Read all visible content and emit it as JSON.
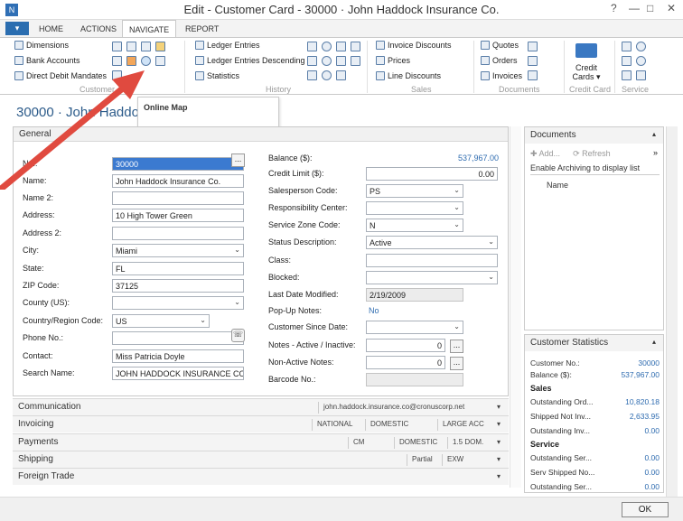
{
  "window": {
    "title": "Edit - Customer Card - 30000 · John Haddock Insurance Co.",
    "help": "?",
    "minimize": "—",
    "maximize": "□",
    "close": "✕"
  },
  "tabs": {
    "file": "▾",
    "home": "HOME",
    "actions": "ACTIONS",
    "navigate": "NAVIGATE",
    "report": "REPORT"
  },
  "ribbon": {
    "customer_group": {
      "dimensions": "Dimensions",
      "bank_accounts": "Bank Accounts",
      "direct_debit": "Direct Debit Mandates",
      "label": "Customer"
    },
    "history_group": {
      "ledger_entries": "Ledger Entries",
      "ledger_entries_desc": "Ledger Entries Descending",
      "statistics": "Statistics",
      "label": "History"
    },
    "sales_group": {
      "invoice_discounts": "Invoice Discounts",
      "prices": "Prices",
      "line_discounts": "Line Discounts",
      "label": "Sales"
    },
    "documents_group": {
      "quotes": "Quotes",
      "orders": "Orders",
      "invoices": "Invoices",
      "label": "Documents"
    },
    "credit_card_group": {
      "button": "Credit Cards ▾",
      "label": "Credit Card"
    },
    "service_group": {
      "label": "Service"
    }
  },
  "tooltip": {
    "text": "Online Map"
  },
  "page_title": "30000 · John Haddock",
  "general": {
    "header": "General",
    "fields_left": [
      {
        "label": "No.:",
        "value": "30000"
      },
      {
        "label": "Name:",
        "value": "John Haddock Insurance Co."
      },
      {
        "label": "Name 2:",
        "value": ""
      },
      {
        "label": "Address:",
        "value": "10 High Tower Green"
      },
      {
        "label": "Address 2:",
        "value": ""
      },
      {
        "label": "City:",
        "value": "Miami"
      },
      {
        "label": "State:",
        "value": "FL"
      },
      {
        "label": "ZIP Code:",
        "value": "37125"
      },
      {
        "label": "County (US):",
        "value": ""
      },
      {
        "label": "Country/Region Code:",
        "value": "US"
      },
      {
        "label": "Phone No.:",
        "value": ""
      },
      {
        "label": "Contact:",
        "value": "Miss Patricia Doyle"
      },
      {
        "label": "Search Name:",
        "value": "JOHN HADDOCK INSURANCE CO."
      }
    ],
    "fields_right": [
      {
        "label": "Balance ($):",
        "value": "537,967.00"
      },
      {
        "label": "Credit Limit ($):",
        "value": "0.00"
      },
      {
        "label": "Salesperson Code:",
        "value": "PS"
      },
      {
        "label": "Responsibility Center:",
        "value": ""
      },
      {
        "label": "Service Zone Code:",
        "value": "N"
      },
      {
        "label": "Status Description:",
        "value": "Active"
      },
      {
        "label": "Class:",
        "value": ""
      },
      {
        "label": "Blocked:",
        "value": ""
      },
      {
        "label": "Last Date Modified:",
        "value": "2/19/2009"
      },
      {
        "label": "Pop-Up Notes:",
        "value": "No"
      },
      {
        "label": "Customer Since Date:",
        "value": ""
      },
      {
        "label": "Notes - Active / Inactive:",
        "value": "0"
      },
      {
        "label": "Non-Active Notes:",
        "value": "0"
      },
      {
        "label": "Barcode No.:",
        "value": ""
      }
    ]
  },
  "collapsed_tabs": [
    {
      "label": "Communication",
      "summary": [
        "john.haddock.insurance.co@cronuscorp.net"
      ]
    },
    {
      "label": "Invoicing",
      "summary": [
        "NATIONAL",
        "DOMESTIC",
        "LARGE ACC"
      ]
    },
    {
      "label": "Payments",
      "summary": [
        "CM",
        "DOMESTIC",
        "1.5 DOM."
      ]
    },
    {
      "label": "Shipping",
      "summary": [
        "Partial",
        "EXW"
      ]
    },
    {
      "label": "Foreign Trade",
      "summary": []
    }
  ],
  "documents_factbox": {
    "title": "Documents",
    "add": "Add...",
    "refresh": "Refresh",
    "archiving_msg": "Enable Archiving to display list",
    "column_name": "Name"
  },
  "customer_statistics": {
    "title": "Customer Statistics",
    "rows_top": [
      {
        "label": "Customer No.:",
        "value": "30000"
      },
      {
        "label": "Balance ($):",
        "value": "537,967.00"
      }
    ],
    "sales_label": "Sales",
    "sales_rows": [
      {
        "label": "Outstanding Ord...",
        "value": "10,820.18"
      },
      {
        "label": "Shipped Not Inv...",
        "value": "2,633.95"
      },
      {
        "label": "Outstanding Inv...",
        "value": "0.00"
      }
    ],
    "service_label": "Service",
    "service_rows": [
      {
        "label": "Outstanding Ser...",
        "value": "0.00"
      },
      {
        "label": "Serv Shipped No...",
        "value": "0.00"
      },
      {
        "label": "Outstanding Ser...",
        "value": "0.00"
      }
    ]
  },
  "ok_button": "OK",
  "colors": {
    "accent": "#2c5b8a",
    "selection": "#3b7ad0",
    "arrow": "#e04a3f"
  }
}
